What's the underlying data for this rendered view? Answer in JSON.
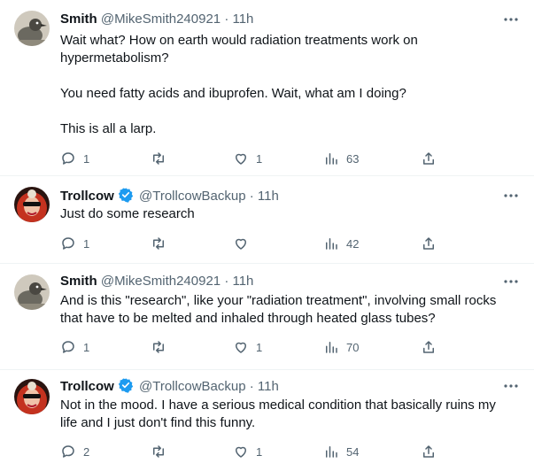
{
  "colors": {
    "text": "#0f1419",
    "secondary": "#536471",
    "verified": "#1d9bf0",
    "divider": "#eff3f4"
  },
  "tweets": [
    {
      "name": "Smith",
      "handle": "@MikeSmith240921",
      "time": "11h",
      "verified": false,
      "avatar_icon": "bird-avatar",
      "text": "Wait what? How on earth would radiation treatments work  on hypermetabolism?\n\nYou need fatty acids and ibuprofen.  Wait, what am I doing?\n\nThis is all a larp.",
      "replies": "1",
      "retweets": "",
      "likes": "1",
      "views": "63"
    },
    {
      "name": "Trollcow",
      "handle": "@TrollcowBackup",
      "time": "11h",
      "verified": true,
      "avatar_icon": "red-hair-avatar",
      "text": "Just do some research",
      "replies": "1",
      "retweets": "",
      "likes": "",
      "views": "42"
    },
    {
      "name": "Smith",
      "handle": "@MikeSmith240921",
      "time": "11h",
      "verified": false,
      "avatar_icon": "bird-avatar",
      "text": "And is this \"research\", like your \"radiation treatment\", involving small rocks that have to be melted and inhaled through heated glass tubes?",
      "replies": "1",
      "retweets": "",
      "likes": "1",
      "views": "70"
    },
    {
      "name": "Trollcow",
      "handle": "@TrollcowBackup",
      "time": "11h",
      "verified": true,
      "avatar_icon": "red-hair-avatar",
      "text": "Not in the mood. I have a serious medical condition that basically ruins my life and I just don't find this funny.",
      "replies": "2",
      "retweets": "",
      "likes": "1",
      "views": "54"
    }
  ]
}
